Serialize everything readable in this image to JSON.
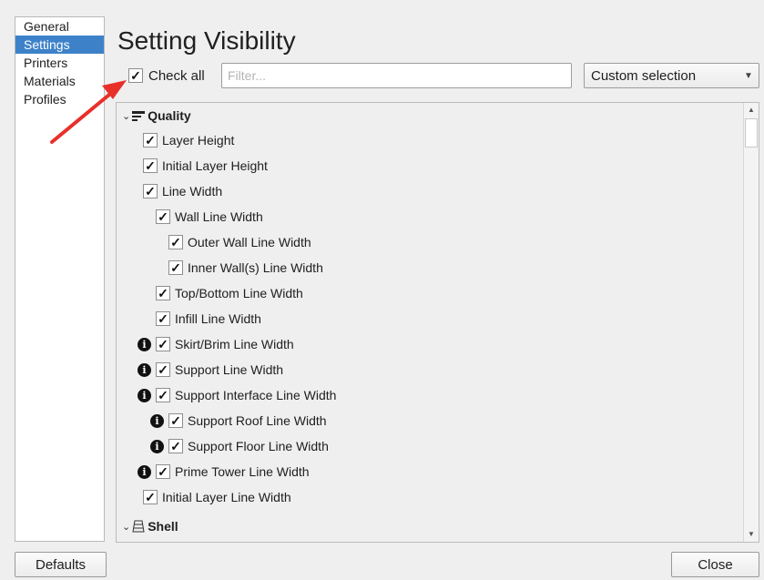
{
  "sidebar": {
    "items": [
      {
        "label": "General",
        "selected": false
      },
      {
        "label": "Settings",
        "selected": true
      },
      {
        "label": "Printers",
        "selected": false
      },
      {
        "label": "Materials",
        "selected": false
      },
      {
        "label": "Profiles",
        "selected": false
      }
    ]
  },
  "page": {
    "title": "Setting Visibility",
    "check_all": {
      "label": "Check all",
      "checked": true
    },
    "filter": {
      "placeholder": "Filter...",
      "value": ""
    },
    "preset": {
      "selected": "Custom selection"
    }
  },
  "settings": {
    "categories": [
      {
        "label": "Quality",
        "icon": "quality-icon",
        "expanded": true
      },
      {
        "label": "Shell",
        "icon": "shell-icon",
        "expanded": true
      }
    ],
    "items": [
      {
        "label": "Layer Height",
        "level": 1,
        "checked": true,
        "info": false
      },
      {
        "label": "Initial Layer Height",
        "level": 1,
        "checked": true,
        "info": false
      },
      {
        "label": "Line Width",
        "level": 1,
        "checked": true,
        "info": false
      },
      {
        "label": "Wall Line Width",
        "level": 2,
        "checked": true,
        "info": false
      },
      {
        "label": "Outer Wall Line Width",
        "level": 3,
        "checked": true,
        "info": false
      },
      {
        "label": "Inner Wall(s) Line Width",
        "level": 3,
        "checked": true,
        "info": false
      },
      {
        "label": "Top/Bottom Line Width",
        "level": 2,
        "checked": true,
        "info": false
      },
      {
        "label": "Infill Line Width",
        "level": 2,
        "checked": true,
        "info": false
      },
      {
        "label": "Skirt/Brim Line Width",
        "level": 2,
        "checked": true,
        "info": true
      },
      {
        "label": "Support Line Width",
        "level": 2,
        "checked": true,
        "info": true
      },
      {
        "label": "Support Interface Line Width",
        "level": 2,
        "checked": true,
        "info": true
      },
      {
        "label": "Support Roof Line Width",
        "level": 3,
        "checked": true,
        "info": true
      },
      {
        "label": "Support Floor Line Width",
        "level": 3,
        "checked": true,
        "info": true
      },
      {
        "label": "Prime Tower Line Width",
        "level": 2,
        "checked": true,
        "info": true
      },
      {
        "label": "Initial Layer Line Width",
        "level": 1,
        "checked": true,
        "info": false
      }
    ]
  },
  "buttons": {
    "defaults": "Defaults",
    "close": "Close"
  },
  "colors": {
    "selection": "#3d82c9",
    "annotation_arrow": "#e8302a"
  },
  "icons": {
    "checkmark": "✓",
    "info": "i",
    "chevron": "⌄",
    "scroll_up": "▲",
    "scroll_down": "▼",
    "dropdown": "▼"
  }
}
